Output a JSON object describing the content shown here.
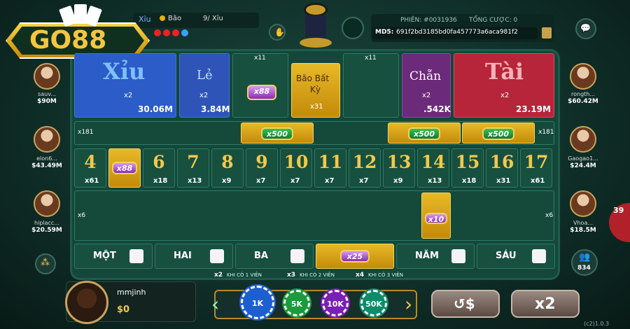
{
  "logo": {
    "text": "GO88"
  },
  "topbar": {
    "xiu_label": "Xỉu",
    "bao_label": "Bão",
    "history_count": "9/ Xỉu",
    "session_label": "PHIÊN: #0031936",
    "total_bet_label": "TỔNG CƯỢC: 0",
    "md5_label": "MD5:",
    "md5_value": "691f2bd3185bd0fa457773a6aca981f2"
  },
  "bets": {
    "xiu": {
      "label": "Xỉu",
      "mult": "x2",
      "amount": "30.06M"
    },
    "le": {
      "label": "Lẻ",
      "mult": "x2",
      "amount": "3.84M"
    },
    "bao_any": {
      "top": "x11",
      "badge": "x88"
    },
    "bao_bat_ky": {
      "label1": "Bão Bất",
      "label2": "Kỳ",
      "mult": "x31"
    },
    "bao_right": {
      "top": "x11"
    },
    "chan": {
      "label": "Chẵn",
      "mult": "x2",
      "amount": ".542K"
    },
    "tai": {
      "label": "Tài",
      "mult": "x2",
      "amount": "23.19M"
    }
  },
  "triples_row": {
    "left_mult": "x181",
    "right_mult": "x181",
    "badge1": "x500",
    "badge2": "x500",
    "badge3": "x500"
  },
  "sums": [
    {
      "n": "4",
      "m": "x61"
    },
    {
      "n": "",
      "m": "",
      "badge": "x88"
    },
    {
      "n": "6",
      "m": "x18"
    },
    {
      "n": "7",
      "m": "x13"
    },
    {
      "n": "8",
      "m": "x9"
    },
    {
      "n": "9",
      "m": "x7"
    },
    {
      "n": "10",
      "m": "x7"
    },
    {
      "n": "11",
      "m": "x7"
    },
    {
      "n": "12",
      "m": "x7"
    },
    {
      "n": "13",
      "m": "x9"
    },
    {
      "n": "14",
      "m": "x13"
    },
    {
      "n": "15",
      "m": "x18"
    },
    {
      "n": "16",
      "m": "x31"
    },
    {
      "n": "17",
      "m": "x61"
    }
  ],
  "pairs_row": {
    "left_mult": "x6",
    "right_mult": "x6",
    "badge": "x10"
  },
  "singles": [
    {
      "label": "MỘT"
    },
    {
      "label": "HAI"
    },
    {
      "label": "BA"
    },
    {
      "label": "",
      "badge": "x25"
    },
    {
      "label": "NĂM"
    },
    {
      "label": "SÁU"
    }
  ],
  "single_payouts": [
    {
      "mult": "x2",
      "text": "KHI CÓ 1 VIÊN"
    },
    {
      "mult": "x3",
      "text": "KHI CÓ 2 VIÊN"
    },
    {
      "mult": "x4",
      "text": "KHI CÓ 3 VIÊN"
    }
  ],
  "players_left": [
    {
      "name": "sauv...",
      "money": "$90M"
    },
    {
      "name": "elon6...",
      "money": "$43.49M"
    },
    {
      "name": "hiplacc...",
      "money": "$20.59M"
    }
  ],
  "players_right": [
    {
      "name": "rongth...",
      "money": "$60.42M"
    },
    {
      "name": "Gaogao1...",
      "money": "$24.4M"
    },
    {
      "name": "Vhoa...",
      "money": "$18.5M"
    }
  ],
  "me": {
    "name": "mmjinh",
    "money": "$0"
  },
  "chips": [
    {
      "label": "1K",
      "color": "#1d5fd1"
    },
    {
      "label": "5K",
      "color": "#1c9a3c"
    },
    {
      "label": "10K",
      "color": "#7a1fb5"
    },
    {
      "label": "50K",
      "color": "#0f8a6a"
    }
  ],
  "controls": {
    "rebet_label": "↺$",
    "double_label": "x2",
    "online_count": "834",
    "side_badge": "39"
  },
  "version": "(c2)1.0.3"
}
